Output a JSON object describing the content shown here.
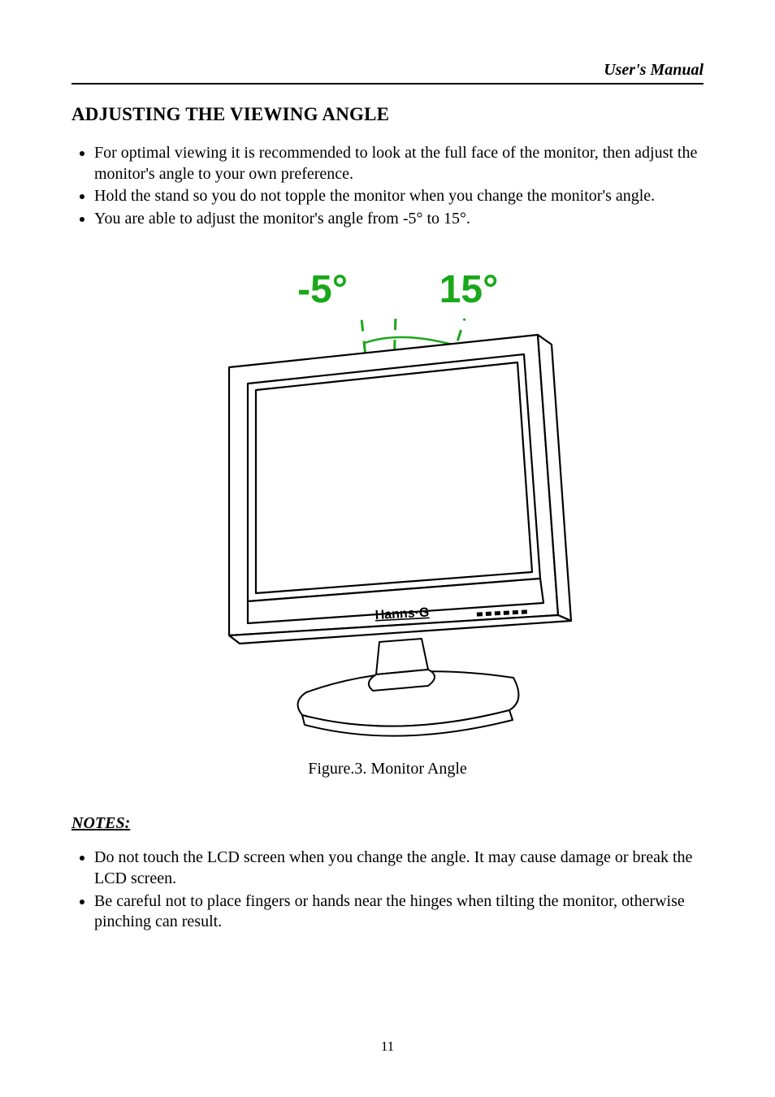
{
  "header": {
    "label": "User's Manual"
  },
  "section": {
    "title": "ADJUSTING THE VIEWING ANGLE"
  },
  "intro_bullets": [
    "For optimal viewing it is recommended to look at the full face of the monitor, then adjust the monitor's angle to your own preference.",
    "Hold the stand so you do not topple the monitor when you change the monitor's angle.",
    "You are able to adjust the monitor's angle from -5° to 15°."
  ],
  "figure": {
    "angle_left_label": "-5°",
    "angle_right_label": "15°",
    "brand_text": "Hanns·G",
    "caption_prefix": "Figure.3.",
    "caption_text": "Monitor Angle"
  },
  "notes": {
    "heading": "NOTES:",
    "bullets": [
      "Do not touch the LCD screen when you change the angle. It may cause damage or break the LCD screen.",
      "Be careful not to place fingers or hands near the hinges when tilting the monitor, otherwise pinching can result."
    ]
  },
  "page_number": "11"
}
